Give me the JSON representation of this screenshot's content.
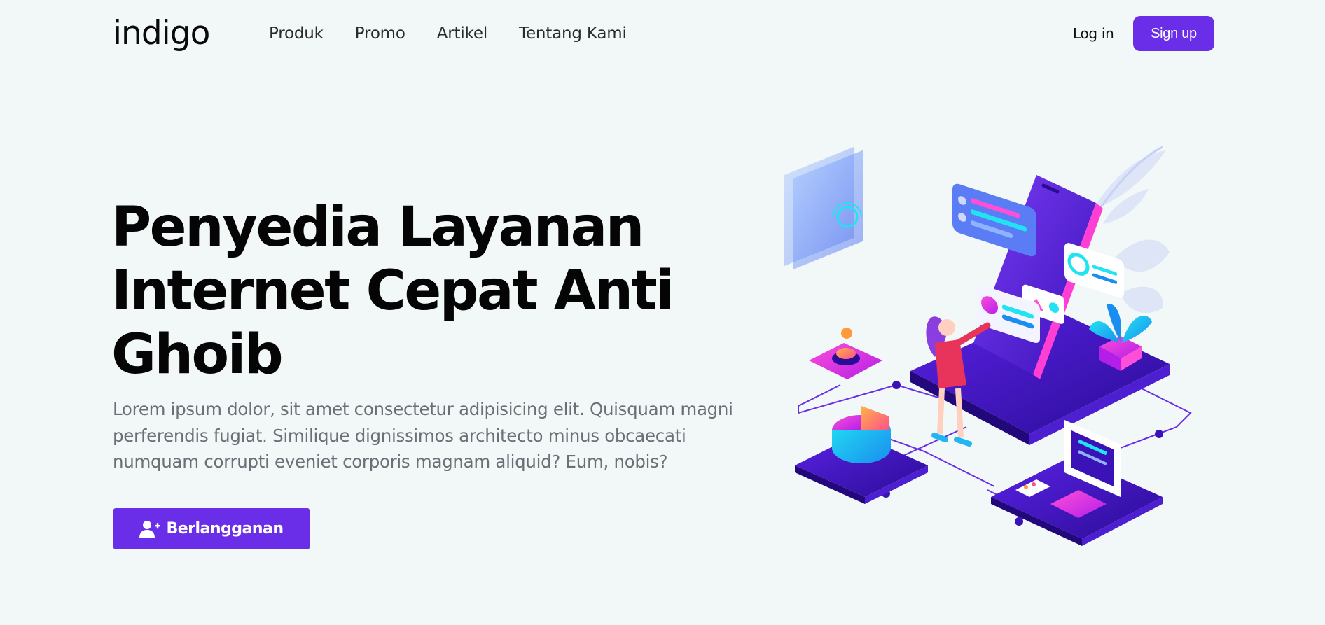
{
  "header": {
    "logo": "indigo",
    "nav": [
      "Produk",
      "Promo",
      "Artikel",
      "Tentang Kami"
    ],
    "login_label": "Log in",
    "signup_label": "Sign up"
  },
  "hero": {
    "title_lines": [
      "Penyedia Layanan",
      "Internet Cepat Anti",
      "Ghoib"
    ],
    "description_lines": [
      "Lorem ipsum dolor, sit amet consectetur adipisicing elit. Quisquam magni",
      "perferendis fugiat. Similique dignissimos architecto minus obcaecati",
      "numquam corrupti eveniet corporis magnam aliquid? Eum, nobis?"
    ],
    "cta_label": "Berlangganan",
    "cta_icon": "user-plus-icon"
  },
  "colors": {
    "accent": "#6a2ee8",
    "background": "#f2f8f8",
    "text_muted": "#6b6f76"
  }
}
